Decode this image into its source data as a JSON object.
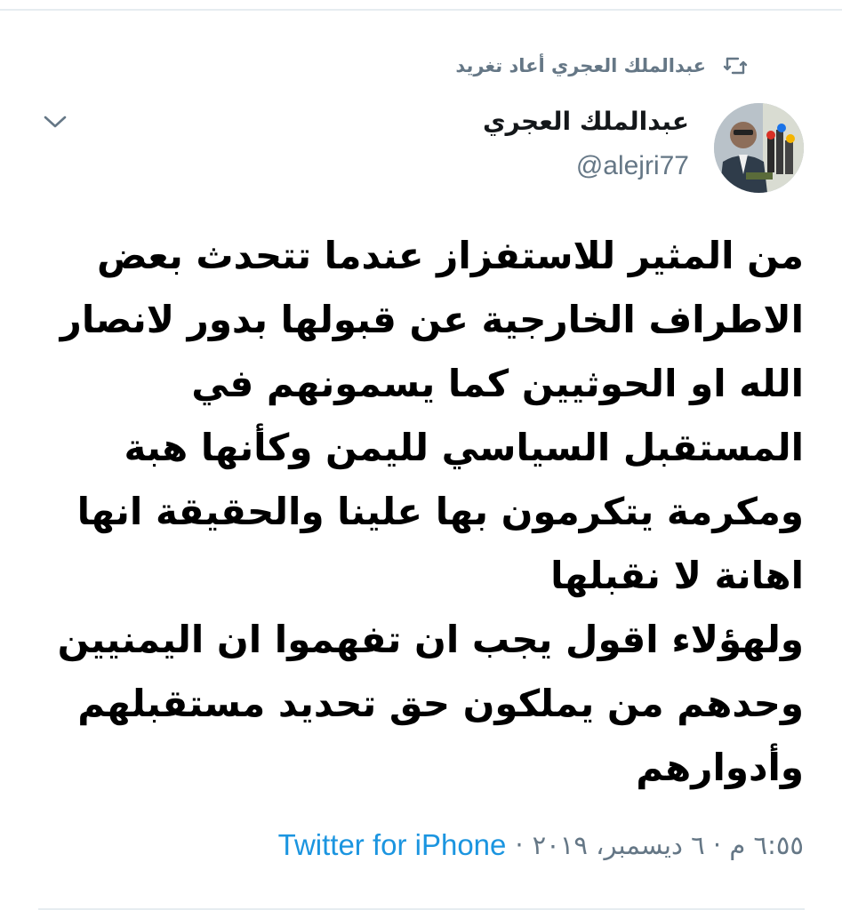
{
  "retweet": {
    "label": "عبدالملك العجري أعاد تغريد",
    "icon": "retweet-icon"
  },
  "author": {
    "name": "عبدالملك العجري",
    "handle": "@alejri77"
  },
  "tweet": {
    "lines": [
      "من المثير للاستفزاز  عندما تتحدث بعض",
      "الاطراف الخارجية عن قبولها بدور لانصار",
      "الله او الحوثيين كما يسمونهم في",
      "المستقبل السياسي لليمن وكأنها هبة",
      "ومكرمة يتكرمون بها علينا والحقيقة انها",
      "اهانة لا نقبلها",
      "ولهؤلاء اقول يجب ان تفهموا ان اليمنيين",
      "وحدهم من يملكون حق تحديد مستقبلهم",
      "وأدوارهم"
    ]
  },
  "meta": {
    "timestamp": "٦:٥٥ م · ٦ ديسمبر، ٢٠١٩",
    "separator": "·",
    "source": "Twitter for iPhone"
  },
  "colors": {
    "secondary_text": "#657786",
    "link": "#1b95e0",
    "divider": "#e6ecf0"
  }
}
